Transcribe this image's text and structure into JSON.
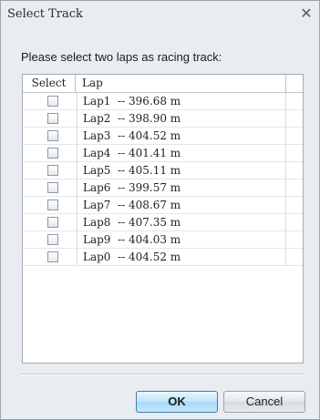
{
  "window": {
    "title": "Select Track",
    "close_glyph": "✕"
  },
  "prompt": "Please select two laps as racing track:",
  "table": {
    "columns": {
      "select": "Select",
      "lap": "Lap"
    },
    "rows": [
      {
        "label": "Lap1  -- 396.68 m",
        "checked": false
      },
      {
        "label": "Lap2  -- 398.90 m",
        "checked": false
      },
      {
        "label": "Lap3  -- 404.52 m",
        "checked": false
      },
      {
        "label": "Lap4  -- 401.41 m",
        "checked": false
      },
      {
        "label": "Lap5  -- 405.11 m",
        "checked": false
      },
      {
        "label": "Lap6  -- 399.57 m",
        "checked": false
      },
      {
        "label": "Lap7  -- 408.67 m",
        "checked": false
      },
      {
        "label": "Lap8  -- 407.35 m",
        "checked": false
      },
      {
        "label": "Lap9  -- 404.03 m",
        "checked": false
      },
      {
        "label": "Lap0  -- 404.52 m",
        "checked": false
      }
    ]
  },
  "buttons": {
    "ok": "OK",
    "cancel": "Cancel"
  },
  "colors": {
    "dialog_bg": "#e9edf1",
    "ok_border": "#3c7fb1",
    "ok_fill": "#bde4f9"
  }
}
